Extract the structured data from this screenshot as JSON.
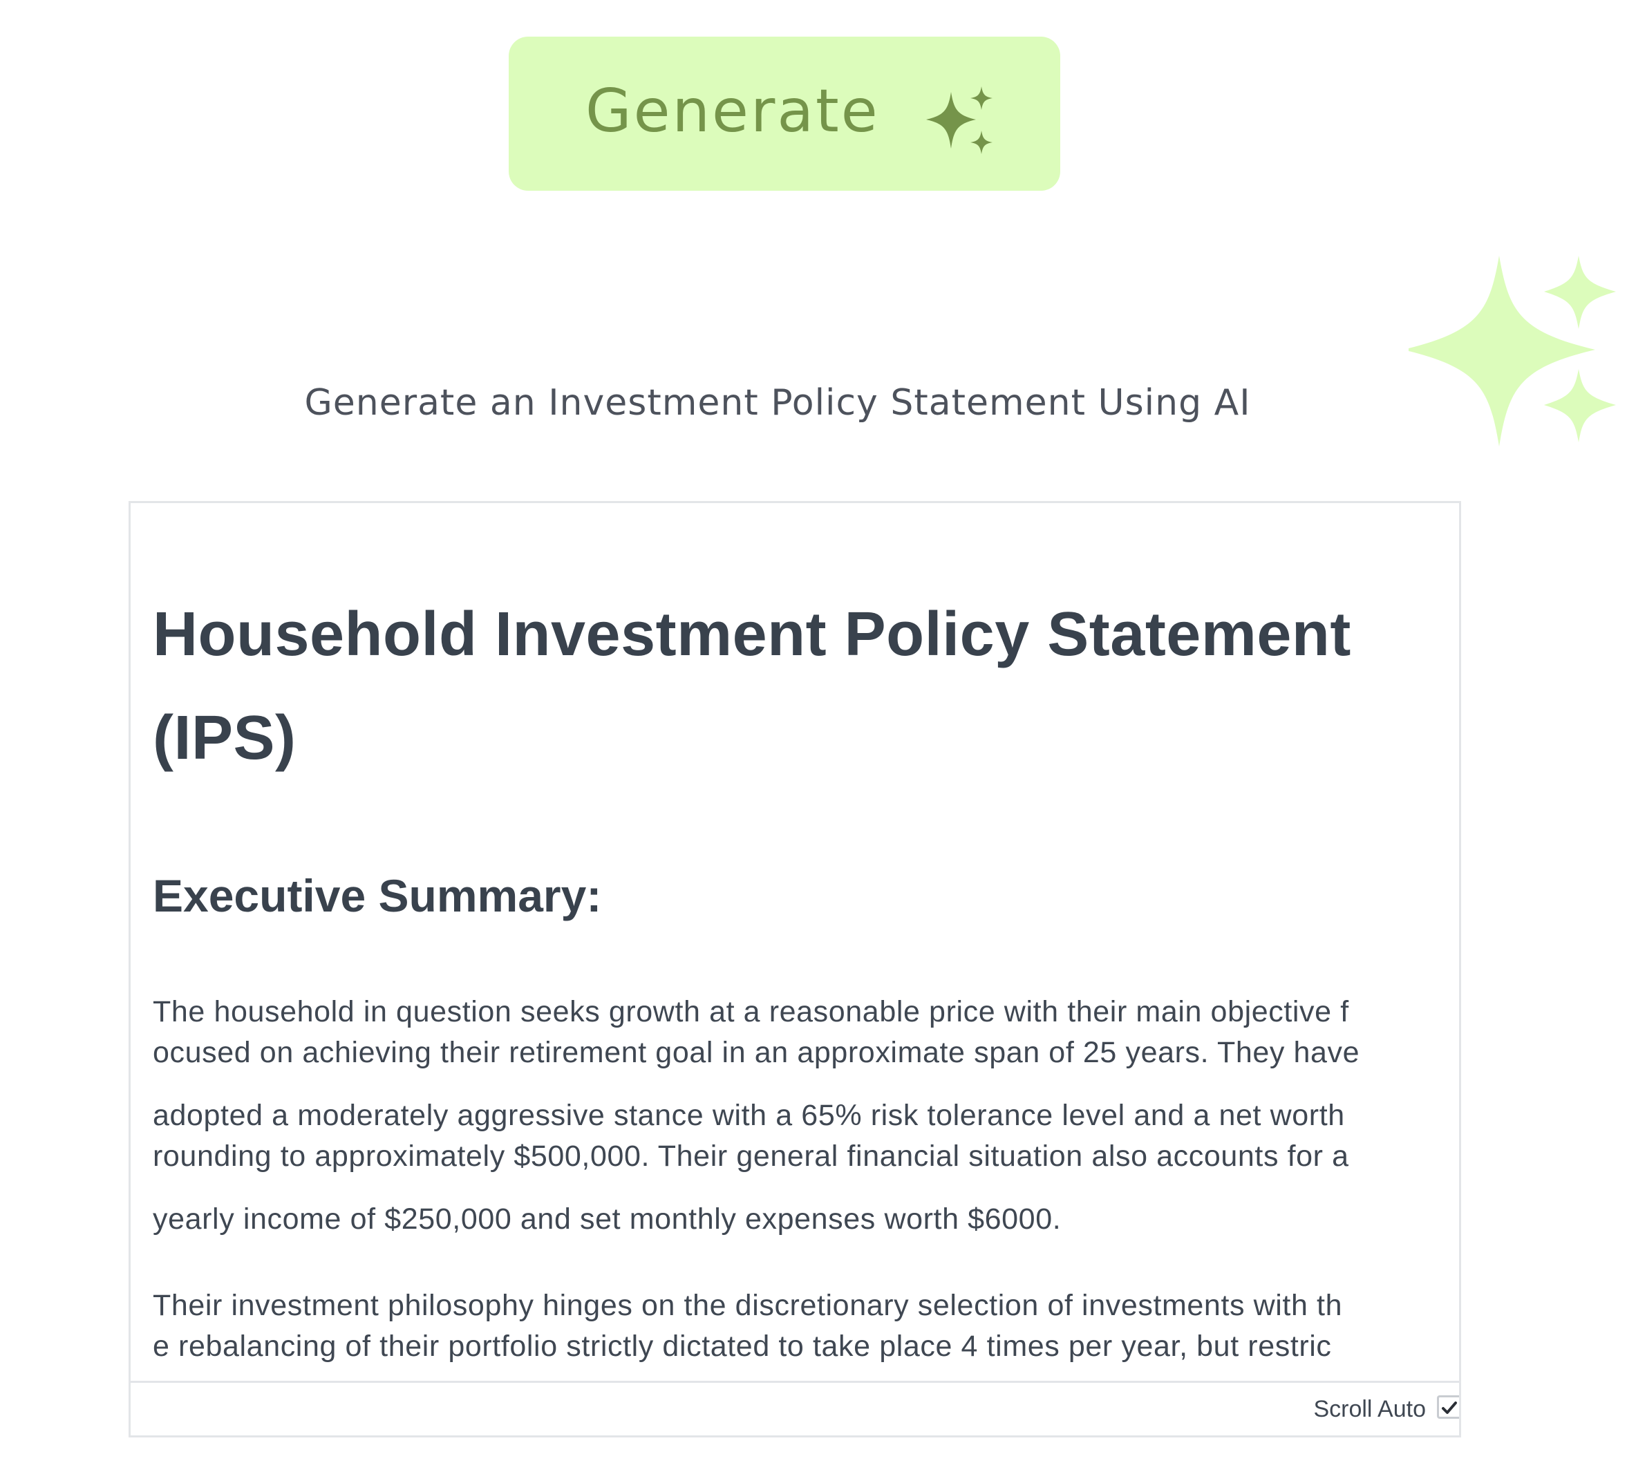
{
  "generate_button": {
    "label": "Generate",
    "icon": "sparkles-icon"
  },
  "decoration": {
    "icon": "sparkles-icon"
  },
  "subtitle": "Generate an Investment Policy Statement Using AI",
  "document": {
    "title": "Household Investment Policy Statement (IPS)",
    "section_heading": "Executive Summary:",
    "paragraph_lines": [
      "The household in question seeks growth at a reasonable price with their main objective f",
      "ocused on achieving their retirement goal in an approximate span of 25 years. They have",
      "adopted a moderately aggressive stance with a 65% risk tolerance level and a net worth",
      "rounding to approximately $500,000. Their general financial situation also accounts for a",
      "yearly income of $250,000 and set monthly expenses worth $6000.",
      "Their investment philosophy hinges on the discretionary selection of investments with th",
      "e rebalancing of their portfolio strictly dictated to take place 4 times per year, but restric"
    ]
  },
  "footer": {
    "scroll_auto_label": "Scroll Auto",
    "scroll_auto_checked": true
  },
  "colors": {
    "accent_light": "#dcfcbb",
    "accent_dark": "#75944a",
    "text_dark": "#39424d",
    "border": "#e3e5e8"
  }
}
